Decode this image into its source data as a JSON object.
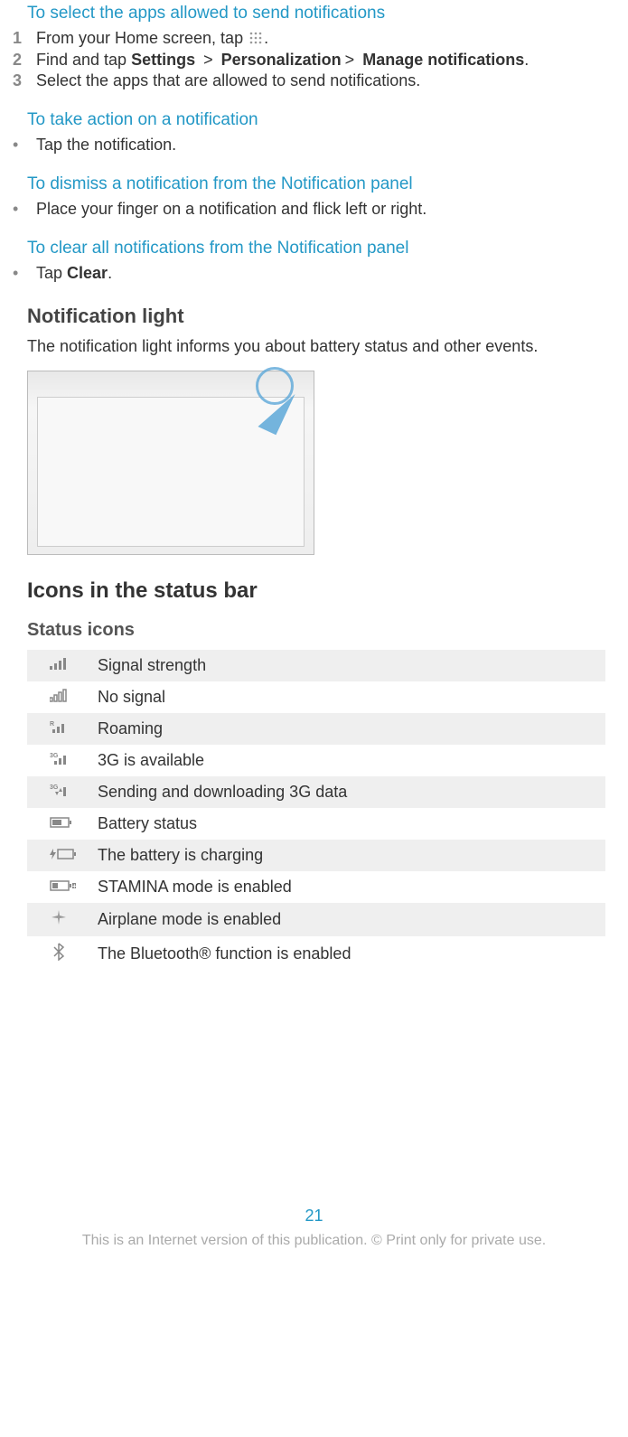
{
  "sections": {
    "select_apps": {
      "title": "To select the apps allowed to send notifications",
      "step1_pre": "From your Home screen, tap ",
      "step1_post": ".",
      "step2_pre": "Find and tap ",
      "step2_b1": "Settings",
      "step2_gt1": ">",
      "step2_b2": "Personalization",
      "step2_gt2": ">",
      "step2_b3": "Manage notifications",
      "step2_post": ".",
      "step3": "Select the apps that are allowed to send notifications."
    },
    "take_action": {
      "title": "To take action on a notification",
      "item": "Tap the notification."
    },
    "dismiss": {
      "title": "To dismiss a notification from the Notification panel",
      "item": "Place your finger on a notification and flick left or right."
    },
    "clear_all": {
      "title": "To clear all notifications from the Notification panel",
      "item_pre": "Tap ",
      "item_b": "Clear",
      "item_post": "."
    },
    "notif_light": {
      "heading": "Notification light",
      "body": "The notification light informs you about battery status and other events."
    },
    "icons_bar": {
      "heading": "Icons in the status bar"
    },
    "status_icons": {
      "heading": "Status icons",
      "rows": [
        {
          "label": "Signal strength",
          "icon": "signal-icon"
        },
        {
          "label": "No signal",
          "icon": "no-signal-icon"
        },
        {
          "label": "Roaming",
          "icon": "roaming-icon"
        },
        {
          "label": "3G is available",
          "icon": "g3-available-icon"
        },
        {
          "label": "Sending and downloading 3G data",
          "icon": "g3-data-icon"
        },
        {
          "label": "Battery status",
          "icon": "battery-icon"
        },
        {
          "label": "The battery is charging",
          "icon": "battery-charging-icon"
        },
        {
          "label": "STAMINA mode is enabled",
          "icon": "stamina-icon"
        },
        {
          "label": "Airplane mode is enabled",
          "icon": "airplane-icon"
        },
        {
          "label": "The Bluetooth® function is enabled",
          "icon": "bluetooth-icon"
        }
      ]
    }
  },
  "page_number": "21",
  "footer": "This is an Internet version of this publication. © Print only for private use."
}
